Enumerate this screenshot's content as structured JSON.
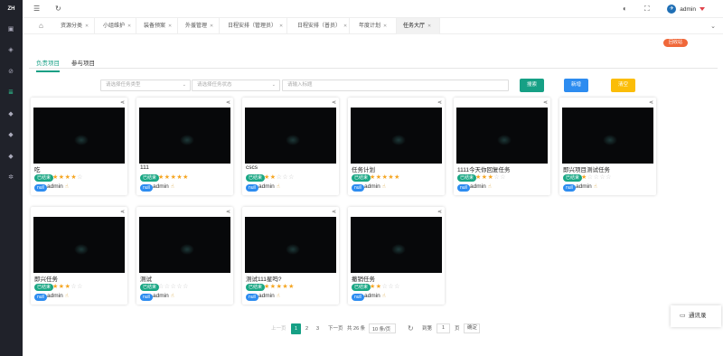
{
  "app": {
    "logo": "ZH"
  },
  "sidebar": {
    "icons": [
      "dashboard-icon",
      "layers-icon",
      "settings-icon",
      "list-icon",
      "tag-icon",
      "tag-icon",
      "tag-icon",
      "gear-icon"
    ],
    "active_index": 3
  },
  "topbar": {
    "user": {
      "name": "admin"
    }
  },
  "tabs": [
    {
      "label": "资源分类"
    },
    {
      "label": "小组维护"
    },
    {
      "label": "装备预案"
    },
    {
      "label": "外援管理"
    },
    {
      "label": "日程安排（管理员）"
    },
    {
      "label": "日程安排（普员）"
    },
    {
      "label": "年度计划"
    },
    {
      "label": "任务大厅",
      "active": true
    }
  ],
  "recycle_label": "回收站",
  "subtabs": [
    {
      "label": "负责项目",
      "active": true
    },
    {
      "label": "参与项目"
    }
  ],
  "filters": {
    "type_placeholder": "请选择任务类型",
    "status_placeholder": "请选择任务状态",
    "title_placeholder": "请输入标题"
  },
  "buttons": {
    "search": "搜索",
    "add": "新增",
    "clear": "清空"
  },
  "colors": {
    "accent": "#16a085",
    "search_btn": "#16a085",
    "add_btn": "#2d8cf0",
    "clear_btn": "#fbbd08",
    "recycle": "#f0683a"
  },
  "cards": [
    {
      "title": "吃",
      "status": "已结束",
      "rating": 4,
      "tag": "null",
      "owner": "admin"
    },
    {
      "title": "111",
      "status": "已结束",
      "rating": 5,
      "tag": "null",
      "owner": "admin"
    },
    {
      "title": "cscs",
      "status": "已结束",
      "rating": 2,
      "tag": "null",
      "owner": "admin"
    },
    {
      "title": "任务计划",
      "status": "已结束",
      "rating": 5,
      "tag": "null",
      "owner": "admin"
    },
    {
      "title": "1111今天你回复任务",
      "status": "已结束",
      "rating": 3,
      "tag": "null",
      "owner": "admin"
    },
    {
      "title": "即兴项目测试任务",
      "status": "已结束",
      "rating": 1,
      "tag": "null",
      "owner": "admin"
    },
    {
      "title": "即兴任务",
      "status": "已结束",
      "rating": 3,
      "tag": "null",
      "owner": "admin"
    },
    {
      "title": "测试",
      "status": "已结束",
      "rating": 0,
      "tag": "null",
      "owner": "admin"
    },
    {
      "title": "测试111星吗?",
      "status": "已结束",
      "rating": 5,
      "tag": "null",
      "owner": "admin"
    },
    {
      "title": "撤销任务",
      "status": "已结束",
      "rating": 2,
      "tag": "null",
      "owner": "admin"
    }
  ],
  "pagination": {
    "prev": "上一页",
    "pages": [
      "1",
      "2",
      "3"
    ],
    "current": "1",
    "next": "下一页",
    "total": "共 26 条",
    "page_size": "10 条/页",
    "goto_label": "到第",
    "goto_value": "1",
    "page_unit": "页",
    "confirm": "确定"
  },
  "chat": {
    "label": "通讯录"
  }
}
